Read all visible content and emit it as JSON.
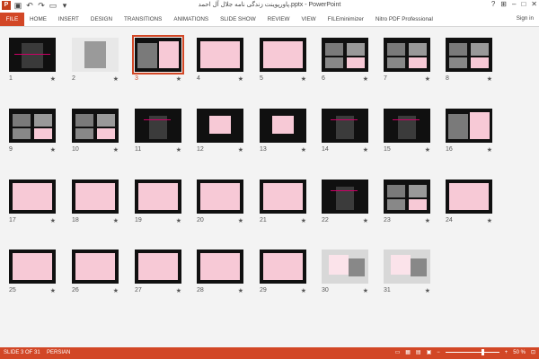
{
  "window": {
    "title": "پاورپوینت زندگی نامه جلال آل احمد.pptx - PowerPoint",
    "signin": "Sign in"
  },
  "ribbon": {
    "file": "FILE",
    "tabs": [
      "HOME",
      "INSERT",
      "DESIGN",
      "TRANSITIONS",
      "ANIMATIONS",
      "SLIDE SHOW",
      "REVIEW",
      "VIEW",
      "FILEminimizer",
      "Nitro PDF Professional"
    ]
  },
  "slides": [
    "1",
    "2",
    "3",
    "4",
    "5",
    "6",
    "7",
    "8",
    "9",
    "10",
    "11",
    "12",
    "13",
    "14",
    "15",
    "16",
    "17",
    "18",
    "19",
    "20",
    "21",
    "22",
    "23",
    "24",
    "25",
    "26",
    "27",
    "28",
    "29",
    "30",
    "31"
  ],
  "selected_slide": 3,
  "status": {
    "slide": "SLIDE 3 OF 31",
    "language": "PERSIAN",
    "zoom": "50 %"
  },
  "colors": {
    "accent": "#d24726",
    "slide_bg": "#101010",
    "content_pink": "#f7c9d6"
  }
}
